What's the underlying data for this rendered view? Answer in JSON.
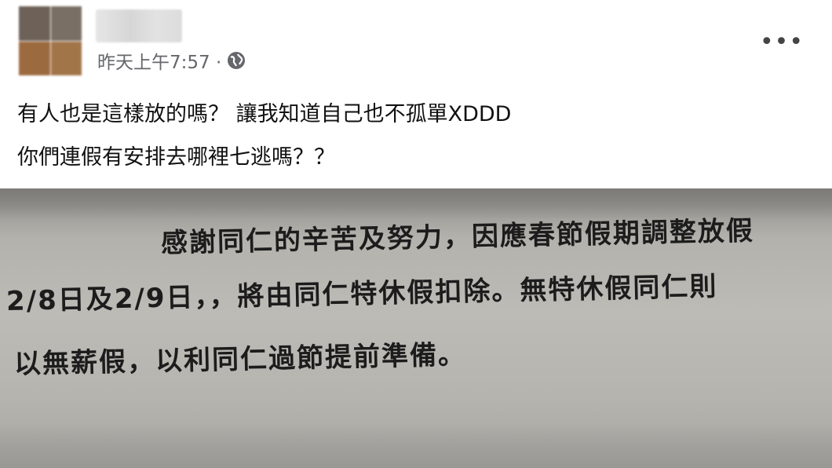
{
  "post": {
    "timestamp": "昨天上午7:57 ·",
    "privacy_icon": "globe-icon",
    "more_label": "•••",
    "text_lines": [
      "有人也是這樣放的嗎？ 讓我知道自己也不孤單XDDD",
      "你們連假有安排去哪裡七逃嗎？？"
    ]
  },
  "photo": {
    "notice_lines": [
      "感謝同仁的辛苦及努力，因應春節假期調整放假",
      "2/8日及2/9日，，將由同仁特休假扣除。無特休假同仁則",
      "以無薪假，以利同仁過節提前準備。"
    ]
  }
}
